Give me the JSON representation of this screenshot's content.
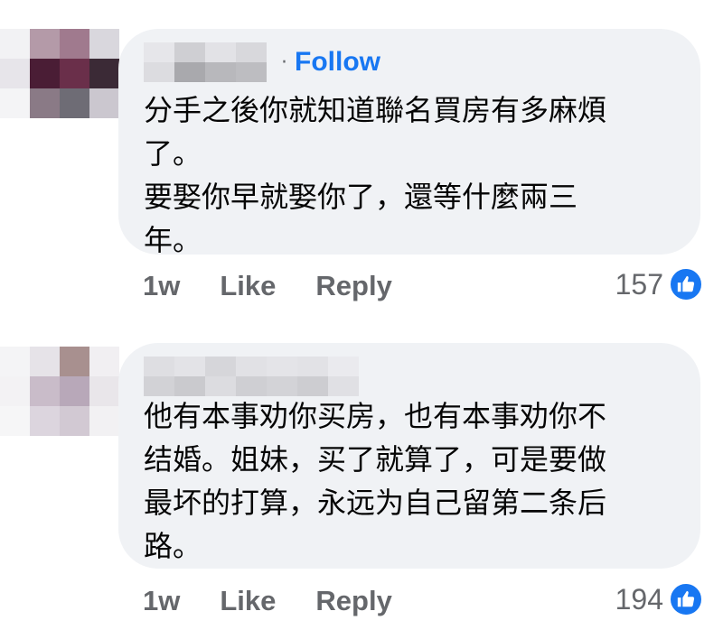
{
  "colors": {
    "bubble_bg": "#f0f2f5",
    "link_blue": "#1877f2",
    "meta_gray": "#65676b",
    "text": "#050505"
  },
  "comments": [
    {
      "author_name": "",
      "author_censored": true,
      "follow_label": "Follow",
      "text_lines": [
        "分手之後你就知道聯名買房有多麻煩",
        "了。",
        "要娶你早就娶你了，還等什麼兩三",
        "年。"
      ],
      "time": "1w",
      "like_label": "Like",
      "reply_label": "Reply",
      "reaction_count": "157",
      "reaction_icon": "thumbs-up-icon"
    },
    {
      "author_name": "",
      "author_censored": true,
      "text_lines": [
        "他有本事劝你买房，也有本事劝你不",
        "结婚。姐妹，买了就算了，可是要做",
        "最坏的打算，永远为自己留第二条后",
        "路。"
      ],
      "time": "1w",
      "like_label": "Like",
      "reply_label": "Reply",
      "reaction_count": "194",
      "reaction_icon": "thumbs-up-icon"
    }
  ]
}
